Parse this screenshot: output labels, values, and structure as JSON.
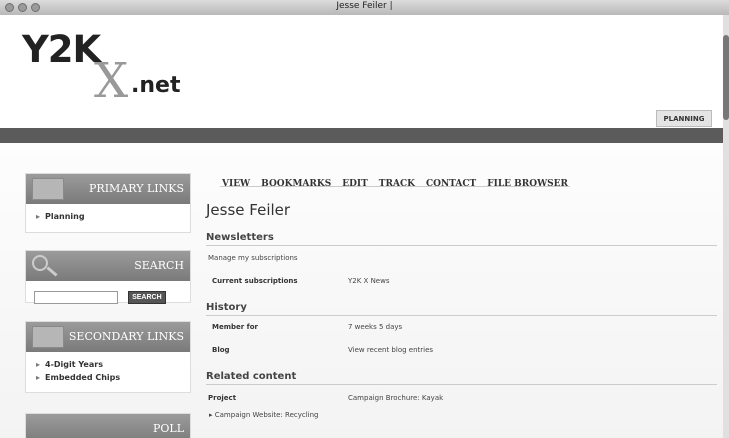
{
  "window": {
    "title": "Jesse Feiler |"
  },
  "site": {
    "logo_main": "Y2K",
    "logo_x": "X",
    "logo_net": ".net"
  },
  "header": {
    "planning_tab": "PLANNING"
  },
  "sidebar": {
    "primary_links": {
      "title": "PRIMARY LINKS",
      "items": [
        "Planning"
      ]
    },
    "search": {
      "title": "SEARCH",
      "input_value": "",
      "button": "SEARCH"
    },
    "secondary_links": {
      "title": "SECONDARY LINKS",
      "items": [
        "4-Digit Years",
        "Embedded Chips"
      ]
    },
    "poll": {
      "title": "POLL"
    }
  },
  "main": {
    "tabs": [
      "VIEW",
      "BOOKMARKS",
      "EDIT",
      "TRACK",
      "CONTACT",
      "FILE BROWSER"
    ],
    "page_title": "Jesse Feiler",
    "newsletters": {
      "heading": "Newsletters",
      "manage_link": "Manage my subscriptions",
      "current_label": "Current subscriptions",
      "current_value": "Y2K X News"
    },
    "history": {
      "heading": "History",
      "member_label": "Member for",
      "member_value": "7 weeks 5 days",
      "blog_label": "Blog",
      "blog_link": "View recent blog entries"
    },
    "related": {
      "heading": "Related content",
      "project_label": "Project",
      "project_value": "Campaign Brochure: Kayak",
      "item": "Campaign Website: Recycling"
    }
  }
}
